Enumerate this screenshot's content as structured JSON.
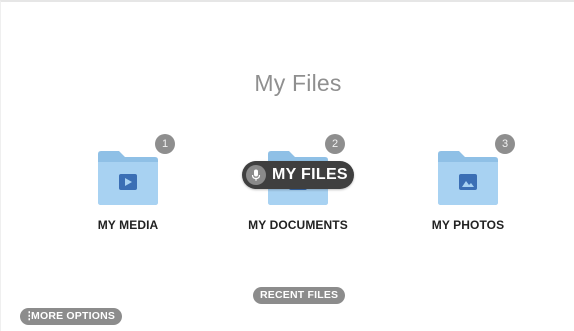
{
  "page": {
    "title": "My Files"
  },
  "tiles": [
    {
      "label": "MY MEDIA",
      "badge": "1",
      "icon": "play-icon"
    },
    {
      "label": "MY DOCUMENTS",
      "badge": "2",
      "icon": "document-icon"
    },
    {
      "label": "MY PHOTOS",
      "badge": "3",
      "icon": "image-icon"
    }
  ],
  "voice_hint": {
    "label": "MY FILES",
    "icon": "microphone-icon"
  },
  "buttons": {
    "recent_files": "RECENT FILES",
    "more_options": "MORE OPTIONS",
    "more_options_icon": "vertical-dots-icon"
  },
  "colors": {
    "folder_back": "#8fc0e6",
    "folder_front": "#a8d2f2",
    "folder_glyph": "#3b6fb5",
    "badge": "#8e8e8e",
    "pill_dark": "#3f3f3f",
    "pill_gray": "#8c8c8c"
  }
}
